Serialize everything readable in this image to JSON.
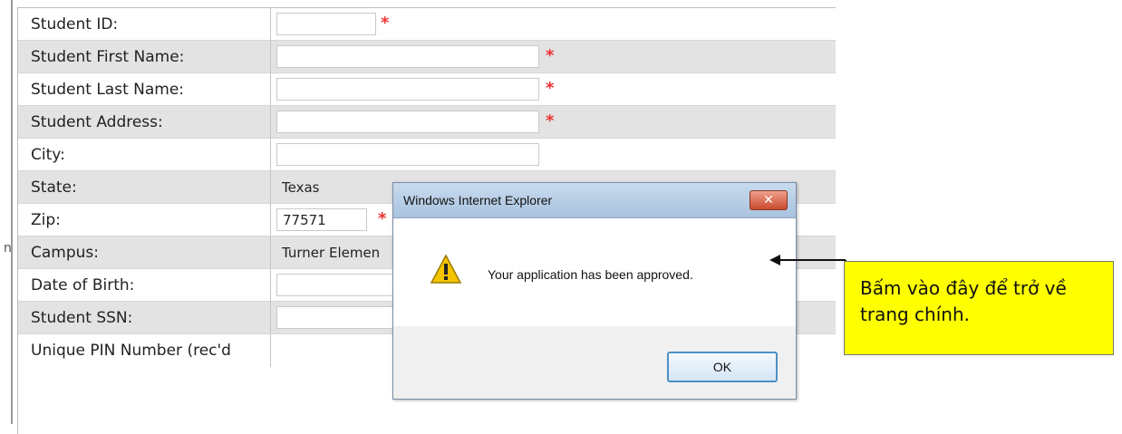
{
  "form": {
    "rows": [
      {
        "label": "Student ID:",
        "value": "",
        "placeholder": ""
      },
      {
        "label": "Student First Name:",
        "value": ""
      },
      {
        "label": "Student Last Name:",
        "value": ""
      },
      {
        "label": "Student Address:",
        "value": ""
      },
      {
        "label": "City:",
        "value": ""
      },
      {
        "label": "State:",
        "value": "Texas"
      },
      {
        "label": "Zip:",
        "value": "77571"
      },
      {
        "label": "Campus:",
        "value": "Turner Elemen"
      },
      {
        "label": "Date of Birth:",
        "value": ""
      },
      {
        "label": "Student SSN:",
        "value": ""
      },
      {
        "label": "Unique PIN Number (rec'd",
        "value": ""
      }
    ],
    "required_mark": "*"
  },
  "dialog": {
    "title": "Windows Internet Explorer",
    "close_glyph": "✕",
    "message": "Your application has been approved.",
    "ok_label": "OK",
    "icon": "warning-icon"
  },
  "callout": {
    "text": "Bấm vào đây để trở về trang chính."
  },
  "margin_mark": "n",
  "colors": {
    "callout_bg": "#ffff00",
    "required": "#e33333",
    "titlebar": "#b7cde4"
  }
}
